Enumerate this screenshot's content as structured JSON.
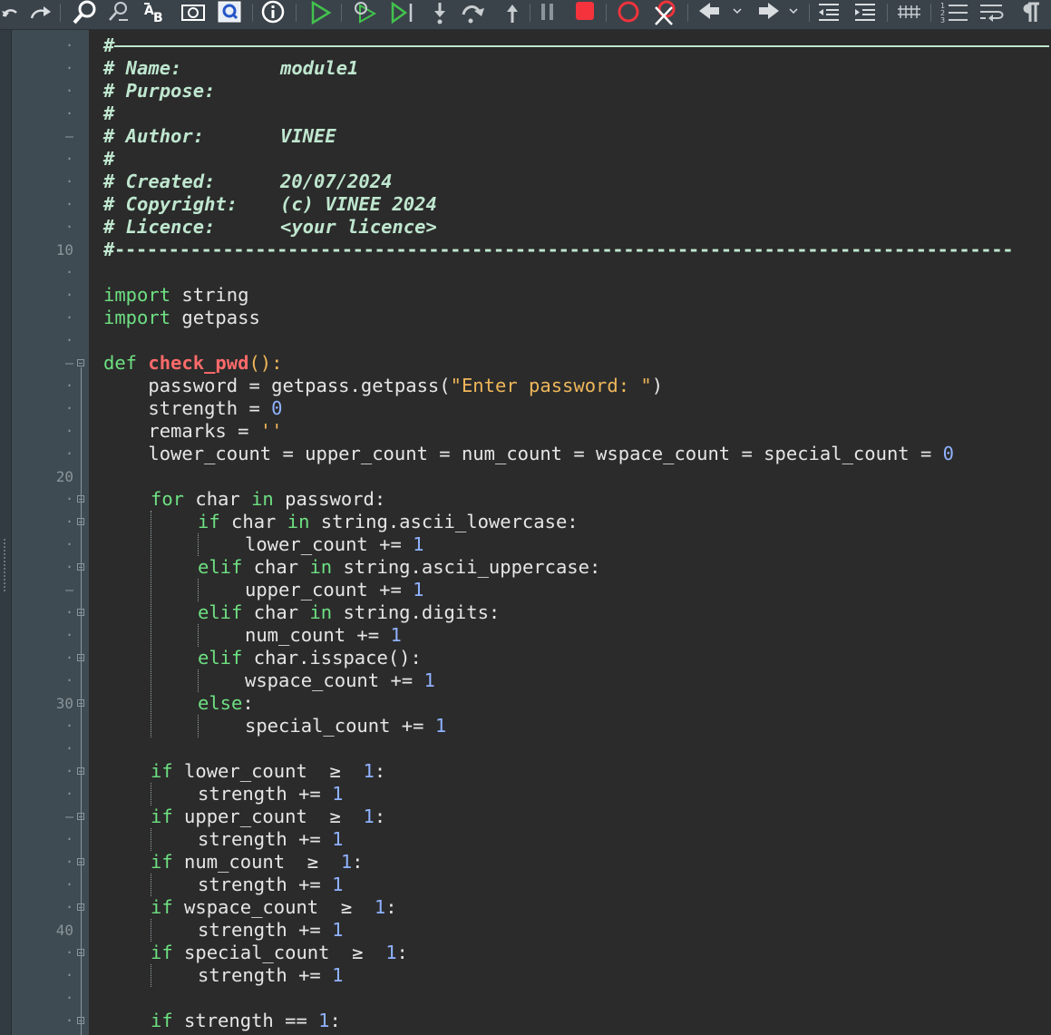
{
  "toolbar": {
    "icons": [
      "undo-icon",
      "redo-icon",
      "find-icon",
      "find-replace-icon",
      "spell-check-icon",
      "screenshot-icon",
      "zoom-search-icon",
      "info-icon",
      "run-icon",
      "debug-icon",
      "step-icon",
      "step-into-icon",
      "step-over-icon",
      "step-out-icon",
      "pause-icon",
      "stop-icon",
      "breakpoint-icon",
      "clear-breakpoints-icon",
      "back-icon",
      "forward-icon",
      "unindent-icon",
      "indent-icon",
      "comment-icon",
      "numbered-list-icon",
      "wrap-icon",
      "pilcrow-icon"
    ]
  },
  "gutter": {
    "line_numbers": [
      "10",
      "20",
      "30",
      "40"
    ]
  },
  "code": {
    "l1": "#",
    "l2_key": "# Name:",
    "l2_val": "module1",
    "l3_key": "# Purpose:",
    "l4": "#",
    "l5_key": "# Author:",
    "l5_val": "VINEE",
    "l6": "#",
    "l7_key": "# Created:",
    "l7_val": "20/07/2024",
    "l8_key": "# Copyright:",
    "l8_val": "(c) VINEE 2024",
    "l9_key": "# Licence:",
    "l9_val": "<your licence>",
    "l10": "#-----------------------------------------------------------------------------------",
    "import1_kw": "import",
    "import1_mod": " string",
    "import2_kw": "import",
    "import2_mod": " getpass",
    "def_kw": "def",
    "def_name": "check_pwd",
    "def_rest": "():",
    "pw_a": "    password = getpass.getpass(",
    "pw_str": "\"Enter password: \"",
    "pw_b": ")",
    "strength_a": "    strength = ",
    "strength_n": "0",
    "remarks_a": "    remarks = ",
    "remarks_s": "''",
    "counts_a": "    lower_count = upper_count = num_count = wspace_count = special_count = ",
    "counts_n": "0",
    "for_kw": "for",
    "for_a": " char ",
    "for_in": "in",
    "for_b": " password:",
    "if1_kw": "if",
    "if1_a": " char ",
    "if1_in": "in",
    "if1_b": " string.ascii_lowercase:",
    "inc_lower": "lower_count += ",
    "elif1_kw": "elif",
    "elif1_a": " char ",
    "elif1_in": "in",
    "elif1_b": " string.ascii_uppercase:",
    "inc_upper": "upper_count += ",
    "elif2_kw": "elif",
    "elif2_a": " char ",
    "elif2_in": "in",
    "elif2_b": " string.digits:",
    "inc_num": "num_count += ",
    "elif3_kw": "elif",
    "elif3_b": " char.isspace():",
    "inc_wspace": "wspace_count += ",
    "else_kw": "else",
    "else_b": ":",
    "inc_special": "special_count += ",
    "one": "1",
    "c1_kw": "if",
    "c1_b": " lower_count  ≥  ",
    "c2_kw": "if",
    "c2_b": " upper_count  ≥  ",
    "c3_kw": "if",
    "c3_b": " num_count  ≥  ",
    "c4_kw": "if",
    "c4_b": " wspace_count  ≥  ",
    "c5_kw": "if",
    "c5_b": " special_count  ≥  ",
    "colon": ":",
    "inc_strength": "strength += ",
    "last_kw": "if",
    "last_b": " strength == "
  },
  "colors": {
    "editor_bg": "#2b2b2b",
    "gutter_bg": "#3f4b53",
    "comment": "#bfe7cf",
    "keyword": "#6ee082",
    "function": "#ff6a6a",
    "string": "#f0b75a",
    "number": "#8fb2ff"
  }
}
